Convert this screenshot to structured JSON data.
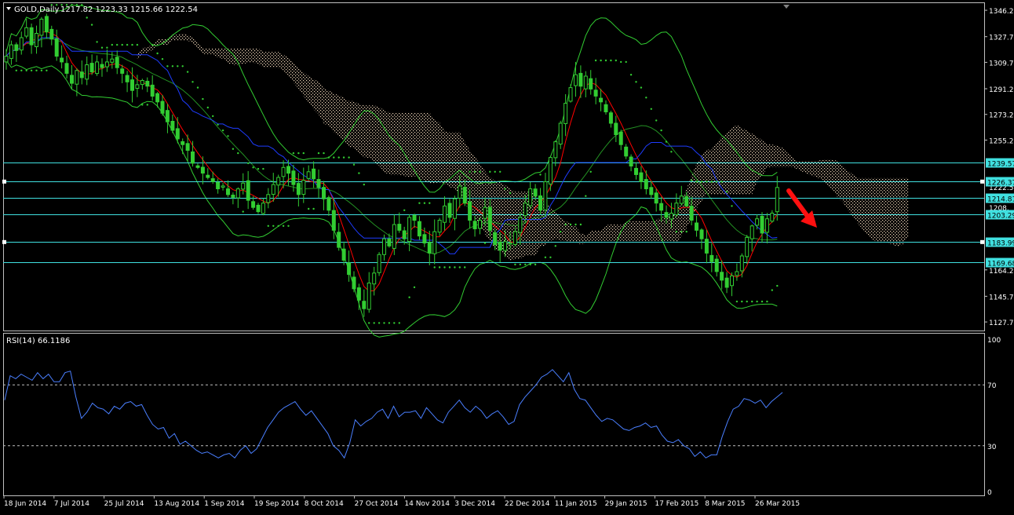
{
  "header": {
    "symbol_title": "GOLD,Daily",
    "ohlc": "1217.82 1223.33 1215.66 1222.54"
  },
  "rsi_panel": {
    "label": "RSI(14) 66.1186"
  },
  "colors": {
    "background": "#000000",
    "axis": "#c0c0c0",
    "candle": "#32cd32",
    "ichimoku_cloud": "#ffe4c4",
    "bollinger": "#32cd32",
    "sar": "#32cd32",
    "tenkan": "#ff0000",
    "kijun": "#1e3cff",
    "hline": "#40e0e0",
    "rsi_line": "#4a7fff",
    "arrow": "#ff1010"
  },
  "chart_data": [
    {
      "type": "candlestick",
      "title": "GOLD,Daily",
      "x_tick_labels": [
        "18 Jun 2014",
        "7 Jul 2014",
        "25 Jul 2014",
        "13 Aug 2014",
        "1 Sep 2014",
        "19 Sep 2014",
        "8 Oct 2014",
        "27 Oct 2014",
        "14 Nov 2014",
        "3 Dec 2014",
        "22 Dec 2014",
        "11 Jan 2015",
        "29 Jan 2015",
        "17 Feb 2015",
        "8 Mar 2015",
        "26 Mar 2015"
      ],
      "y_tick_labels": [
        "1346.20",
        "1327.70",
        "1309.70",
        "1291.20",
        "1273.20",
        "1255.20",
        "1164.20",
        "1145.70",
        "1127.70"
      ],
      "ylim": [
        1121.7,
        1351.2
      ],
      "horizontal_lines": [
        {
          "value": 1239.57,
          "label": "1239.57"
        },
        {
          "value": 1226.37,
          "label": "1226.37"
        },
        {
          "value": 1214.81,
          "label": "1214.81"
        },
        {
          "value": 1203.29,
          "label": "1203.29"
        },
        {
          "value": 1183.99,
          "label": "1183.99"
        },
        {
          "value": 1169.68,
          "label": "1169.68"
        }
      ],
      "overlapping_ticks": [
        "1222.54",
        "1208.",
        "1202.84"
      ],
      "close_series": [
        1314,
        1322,
        1318,
        1327,
        1334,
        1322,
        1330,
        1340,
        1331,
        1326,
        1314,
        1310,
        1302,
        1295,
        1304,
        1299,
        1308,
        1303,
        1310,
        1306,
        1310,
        1312,
        1306,
        1302,
        1296,
        1290,
        1294,
        1297,
        1293,
        1286,
        1282,
        1274,
        1268,
        1262,
        1256,
        1252,
        1248,
        1239,
        1236,
        1232,
        1229,
        1226,
        1221,
        1223,
        1217,
        1215,
        1221,
        1225,
        1213,
        1208,
        1205,
        1211,
        1217,
        1224,
        1229,
        1236,
        1232,
        1224,
        1217,
        1227,
        1233,
        1228,
        1222,
        1214,
        1206,
        1192,
        1180,
        1171,
        1161,
        1151,
        1143,
        1137,
        1155,
        1162,
        1175,
        1186,
        1181,
        1196,
        1192,
        1186,
        1201,
        1199,
        1188,
        1183,
        1176,
        1191,
        1199,
        1209,
        1201,
        1214,
        1223,
        1211,
        1199,
        1193,
        1199,
        1208,
        1192,
        1182,
        1178,
        1184,
        1183,
        1191,
        1201,
        1211,
        1221,
        1216,
        1206,
        1226,
        1243,
        1254,
        1267,
        1281,
        1292,
        1301,
        1293,
        1300,
        1291,
        1286,
        1282,
        1275,
        1267,
        1259,
        1252,
        1244,
        1237,
        1231,
        1226,
        1221,
        1217,
        1211,
        1206,
        1201,
        1204,
        1211,
        1216,
        1209,
        1199,
        1192,
        1186,
        1176,
        1170,
        1163,
        1157,
        1152,
        1160,
        1163,
        1174,
        1187,
        1195,
        1200,
        1190,
        1200,
        1204,
        1222
      ],
      "series": [
        {
          "name": "Tenkan",
          "color": "red"
        },
        {
          "name": "Kijun",
          "color": "blue"
        },
        {
          "name": "Bollinger Bands",
          "color": "green"
        },
        {
          "name": "Parabolic SAR",
          "color": "green dots"
        },
        {
          "name": "Ichimoku cloud",
          "color": "dotted"
        }
      ],
      "annotation": {
        "type": "arrow",
        "direction": "down-right",
        "from": 1232,
        "to": 1204
      }
    },
    {
      "type": "line",
      "title": "RSI(14) 66.1186",
      "y_tick_labels": [
        "100",
        "70",
        "30",
        "0"
      ],
      "ylim": [
        0,
        100
      ],
      "levels": [
        70,
        30
      ],
      "values": [
        60,
        76,
        74,
        77,
        75,
        73,
        78,
        74,
        77,
        72,
        72,
        78,
        79,
        62,
        48,
        52,
        58,
        55,
        54,
        51,
        56,
        54,
        58,
        59,
        56,
        57,
        50,
        44,
        41,
        42,
        35,
        38,
        31,
        33,
        30,
        27,
        25,
        26,
        24,
        22,
        24,
        25,
        22,
        27,
        30,
        25,
        28,
        35,
        42,
        47,
        52,
        55,
        57,
        59,
        54,
        50,
        53,
        48,
        43,
        38,
        30,
        27,
        22,
        32,
        47,
        43,
        46,
        48,
        52,
        54,
        48,
        56,
        49,
        52,
        52,
        53,
        48,
        55,
        51,
        47,
        45,
        52,
        56,
        60,
        55,
        52,
        56,
        53,
        48,
        51,
        53,
        49,
        44,
        46,
        57,
        62,
        66,
        70,
        75,
        77,
        80,
        76,
        72,
        78,
        67,
        61,
        60,
        55,
        50,
        46,
        48,
        47,
        44,
        41,
        40,
        42,
        43,
        45,
        42,
        43,
        37,
        33,
        32,
        34,
        30,
        28,
        23,
        26,
        22,
        24,
        24,
        36,
        46,
        54,
        56,
        61,
        60,
        58,
        60,
        55,
        59,
        62,
        65
      ],
      "rsi_end_value": 66.1186
    }
  ]
}
